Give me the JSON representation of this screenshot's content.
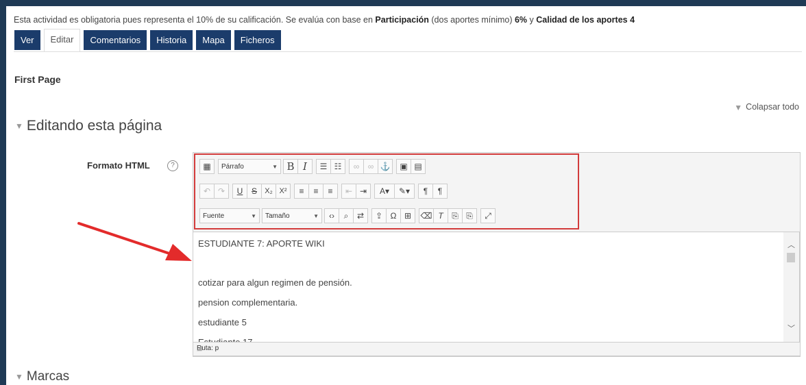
{
  "notice": {
    "text_a": "Esta actividad es obligatoria pues representa el 10% de su calificación. Se evalúa con base en ",
    "bold_a": "Participación",
    "text_b": " (dos aportes mínimo) ",
    "bold_b": "6%",
    "text_c": " y ",
    "bold_c": "Calidad de los aportes 4"
  },
  "tabs": [
    {
      "label": "Ver"
    },
    {
      "label": "Editar"
    },
    {
      "label": "Comentarios"
    },
    {
      "label": "Historia"
    },
    {
      "label": "Mapa"
    },
    {
      "label": "Ficheros"
    }
  ],
  "active_tab": "Editar",
  "page_name": "First Page",
  "collapse_label": "Colapsar todo",
  "section_title": "Editando esta página",
  "format_label": "Formato HTML",
  "editor": {
    "paragraph_select": "Párrafo",
    "font_select": "Fuente",
    "size_select": "Tamaño",
    "lines": [
      "ESTUDIANTE 7: APORTE WIKI",
      "",
      "cotizar para algun regimen de pensión.",
      "pension complementaria.",
      "estudiante 5",
      "Estudiante 17"
    ],
    "path_label": "Ruta: p"
  },
  "marcas_title": "Marcas",
  "colors": {
    "tab_bg": "#1b3c6b",
    "frame": "#1f3a55",
    "highlight": "#d23a3a",
    "arrow": "#e32b2b"
  }
}
